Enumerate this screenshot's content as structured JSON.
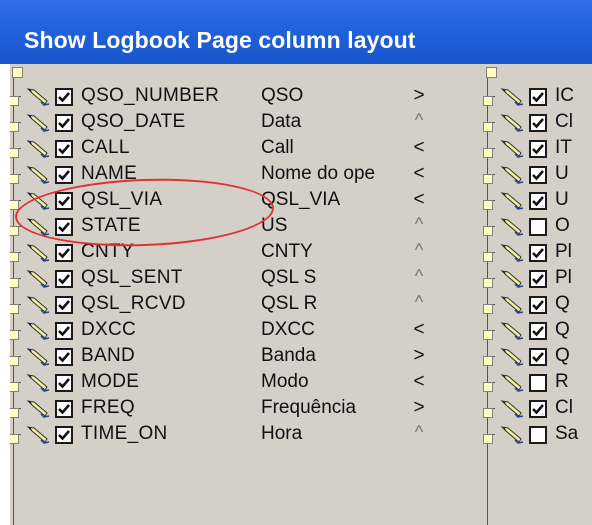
{
  "window": {
    "title": "Show Logbook Page column layout"
  },
  "left_rows": [
    {
      "field": "QSO_NUMBER",
      "caption": "QSO",
      "sort": ">",
      "checked": true
    },
    {
      "field": "QSO_DATE",
      "caption": "Data",
      "sort": "^",
      "checked": true
    },
    {
      "field": "CALL",
      "caption": "Call",
      "sort": "<",
      "checked": true
    },
    {
      "field": "NAME",
      "caption": "Nome do ope",
      "sort": "<",
      "checked": true
    },
    {
      "field": "QSL_VIA",
      "caption": "QSL_VIA",
      "sort": "<",
      "checked": true
    },
    {
      "field": "STATE",
      "caption": "US",
      "sort": "^",
      "checked": true
    },
    {
      "field": "CNTY",
      "caption": "CNTY",
      "sort": "^",
      "checked": true
    },
    {
      "field": "QSL_SENT",
      "caption": "QSL S",
      "sort": "^",
      "checked": true
    },
    {
      "field": "QSL_RCVD",
      "caption": "QSL R",
      "sort": "^",
      "checked": true
    },
    {
      "field": "DXCC",
      "caption": "DXCC",
      "sort": "<",
      "checked": true
    },
    {
      "field": "BAND",
      "caption": "Banda",
      "sort": ">",
      "checked": true
    },
    {
      "field": "MODE",
      "caption": "Modo",
      "sort": "<",
      "checked": true
    },
    {
      "field": "FREQ",
      "caption": "Frequência",
      "sort": ">",
      "checked": true
    },
    {
      "field": "TIME_ON",
      "caption": "Hora",
      "sort": "^",
      "checked": true
    }
  ],
  "right_rows": [
    {
      "field": "IC",
      "checked": true
    },
    {
      "field": "Cl",
      "checked": true
    },
    {
      "field": "IT",
      "checked": true
    },
    {
      "field": "U",
      "checked": true
    },
    {
      "field": "U",
      "checked": true
    },
    {
      "field": "O",
      "checked": false
    },
    {
      "field": "Pl",
      "checked": true
    },
    {
      "field": "Pl",
      "checked": true
    },
    {
      "field": "Q",
      "checked": true
    },
    {
      "field": "Q",
      "checked": true
    },
    {
      "field": "Q",
      "checked": true
    },
    {
      "field": "R",
      "checked": false
    },
    {
      "field": "Cl",
      "checked": true
    },
    {
      "field": "Sa",
      "checked": false
    }
  ],
  "colors": {
    "title_bar": "#1f5fd8",
    "panel": "#d4d0c8",
    "highlight": "#e1303a"
  },
  "icons": {
    "edit": "pencil-icon",
    "check": "checkbox-check-icon",
    "node": "tree-node-icon"
  }
}
